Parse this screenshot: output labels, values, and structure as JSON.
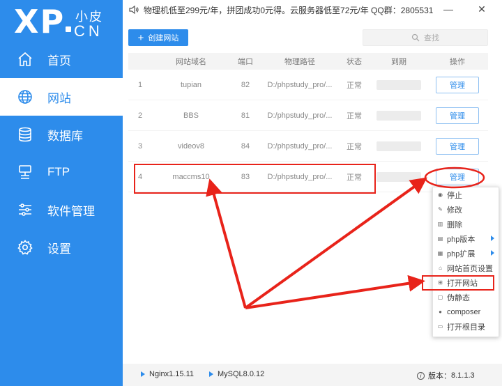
{
  "logo": {
    "xp": "XP",
    "cn_top": "小皮",
    "cn_bottom": "CN"
  },
  "sidebar": {
    "items": [
      {
        "label": "首页",
        "icon": "home-icon"
      },
      {
        "label": "网站",
        "icon": "globe-icon",
        "active": true
      },
      {
        "label": "数据库",
        "icon": "database-icon"
      },
      {
        "label": "FTP",
        "icon": "ftp-icon"
      },
      {
        "label": "软件管理",
        "icon": "sliders-icon"
      },
      {
        "label": "设置",
        "icon": "gear-icon"
      }
    ]
  },
  "topbar": {
    "notice": "物理机低至299元/年，拼团成功0元得。云服务器低至72元/年 QQ群：2805531",
    "minimize": "—",
    "close": "✕"
  },
  "toolbar": {
    "create_label": "创建网站",
    "search_placeholder": "查找"
  },
  "table": {
    "headers": {
      "no": "#",
      "name": "网站域名",
      "port": "端口",
      "path": "物理路径",
      "status": "状态",
      "expire": "到期",
      "op": "操作"
    },
    "rows": [
      {
        "no": "1",
        "name": "tupian",
        "port": "82",
        "path": "D:/phpstudy_pro/...",
        "status": "正常",
        "action": "管理"
      },
      {
        "no": "2",
        "name": "BBS",
        "port": "81",
        "path": "D:/phpstudy_pro/...",
        "status": "正常",
        "action": "管理"
      },
      {
        "no": "3",
        "name": "videov8",
        "port": "84",
        "path": "D:/phpstudy_pro/...",
        "status": "正常",
        "action": "管理"
      },
      {
        "no": "4",
        "name": "maccms10",
        "port": "83",
        "path": "D:/phpstudy_pro/...",
        "status": "正常",
        "action": "管理"
      }
    ]
  },
  "menu": {
    "items": [
      {
        "label": "停止",
        "icon": "stop-icon"
      },
      {
        "label": "修改",
        "icon": "edit-icon"
      },
      {
        "label": "删除",
        "icon": "trash-icon"
      },
      {
        "label": "php版本",
        "icon": "php-icon",
        "submenu": true
      },
      {
        "label": "php扩展",
        "icon": "extension-icon",
        "submenu": true
      },
      {
        "label": "网站首页设置",
        "icon": "home-icon"
      },
      {
        "label": "打开网站",
        "icon": "open-site-icon"
      },
      {
        "label": "伪静态",
        "icon": "rewrite-icon"
      },
      {
        "label": "composer",
        "icon": "composer-icon"
      },
      {
        "label": "打开根目录",
        "icon": "folder-icon"
      }
    ]
  },
  "footer": {
    "nginx": "Nginx1.15.11",
    "mysql": "MySQL8.0.12",
    "version_label": "版本：",
    "version": "8.1.1.3"
  },
  "colors": {
    "accent": "#2d8ceb",
    "annotation": "#e8231a"
  }
}
